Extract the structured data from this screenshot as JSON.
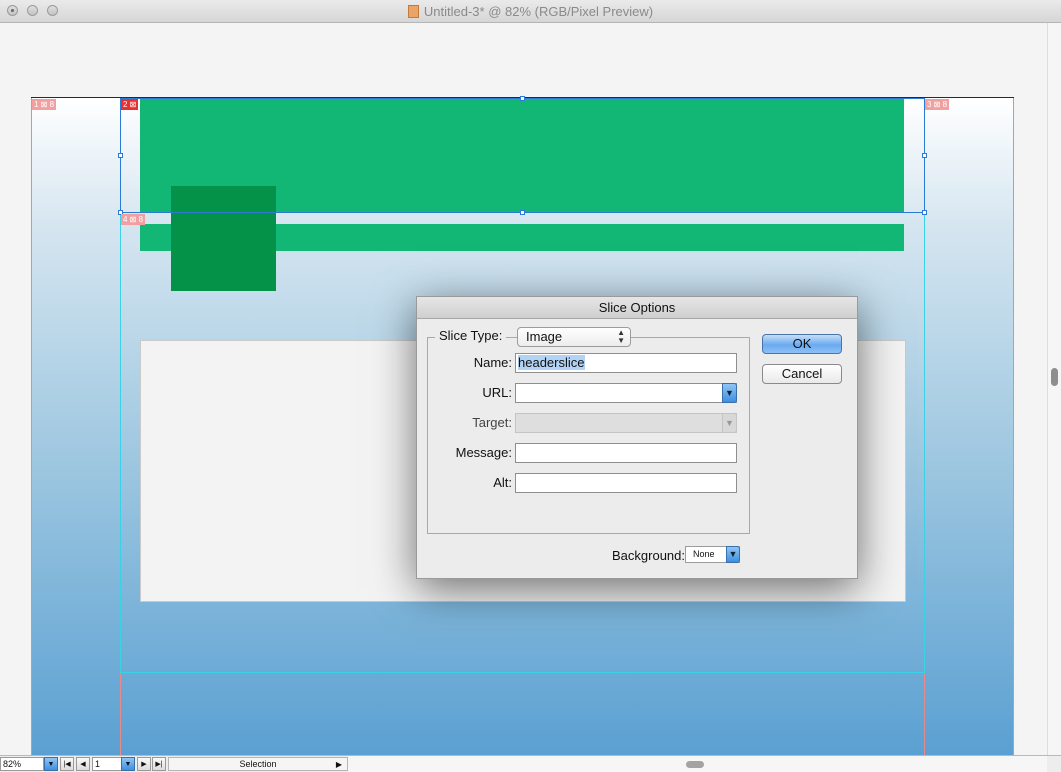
{
  "window": {
    "title": "Untitled-3* @ 82% (RGB/Pixel Preview)"
  },
  "slices": {
    "badges": [
      {
        "number": "1"
      },
      {
        "number": "2"
      },
      {
        "number": "3"
      },
      {
        "number": "4"
      }
    ],
    "badge_link_glyph": "8"
  },
  "dialog": {
    "title": "Slice Options",
    "slice_type_label": "Slice Type:",
    "slice_type_value": "Image",
    "name_label": "Name:",
    "name_value": "headerslice",
    "url_label": "URL:",
    "url_value": "",
    "target_label": "Target:",
    "target_value": "",
    "message_label": "Message:",
    "message_value": "",
    "alt_label": "Alt:",
    "alt_value": "",
    "background_label": "Background:",
    "background_value": "None",
    "ok_label": "OK",
    "cancel_label": "Cancel"
  },
  "statusbar": {
    "zoom": "82%",
    "page": "1",
    "tool": "Selection"
  },
  "colors": {
    "green_bar": "#12b775",
    "green_square": "#039247",
    "selection": "#2b7bd6",
    "slice_guide": "#39d2e6"
  },
  "icons": {
    "close": "close-icon",
    "minimize": "minimize-icon",
    "zoom": "zoom-icon",
    "document": "document-icon",
    "dropdown": "chevron-down-icon",
    "updown": "updown-arrows-icon"
  }
}
